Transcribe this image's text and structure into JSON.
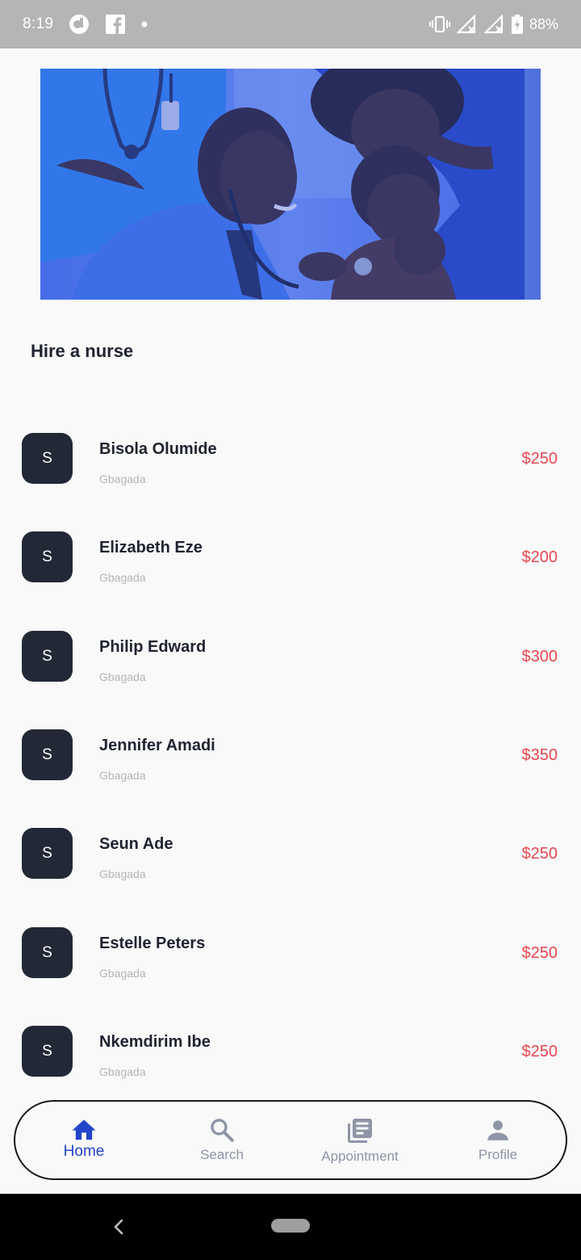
{
  "status_bar": {
    "time": "8:19",
    "battery": "88%",
    "icons": [
      "app-notification-icon",
      "facebook-icon",
      "dot-icon",
      "vibrate-icon",
      "signal-no-sim-icon",
      "signal-no-sim-icon",
      "battery-charging-icon"
    ]
  },
  "hero": {
    "image": "doctor-examining-child-photo"
  },
  "section": {
    "title": "Hire a nurse"
  },
  "nurses": [
    {
      "initial": "S",
      "name": "Bisola Olumide",
      "location": "Gbagada",
      "price": "$250"
    },
    {
      "initial": "S",
      "name": "Elizabeth Eze",
      "location": "Gbagada",
      "price": "$200"
    },
    {
      "initial": "S",
      "name": "Philip Edward",
      "location": "Gbagada",
      "price": "$300"
    },
    {
      "initial": "S",
      "name": "Jennifer Amadi",
      "location": "Gbagada",
      "price": "$350"
    },
    {
      "initial": "S",
      "name": "Seun Ade",
      "location": "Gbagada",
      "price": "$250"
    },
    {
      "initial": "S",
      "name": "Estelle Peters",
      "location": "Gbagada",
      "price": "$250"
    },
    {
      "initial": "S",
      "name": "Nkemdirim Ibe",
      "location": "Gbagada",
      "price": "$250"
    }
  ],
  "bottom_nav": {
    "items": [
      {
        "label": "Home",
        "icon": "home-icon",
        "active": true
      },
      {
        "label": "Search",
        "icon": "search-icon",
        "active": false
      },
      {
        "label": "Appointment",
        "icon": "appointment-icon",
        "active": false
      },
      {
        "label": "Profile",
        "icon": "profile-icon",
        "active": false
      }
    ]
  },
  "colors": {
    "accent": "#2145c9",
    "price": "#e8474f",
    "avatar_bg": "#232836",
    "text": "#1f2330",
    "muted": "#b4b4b8"
  }
}
